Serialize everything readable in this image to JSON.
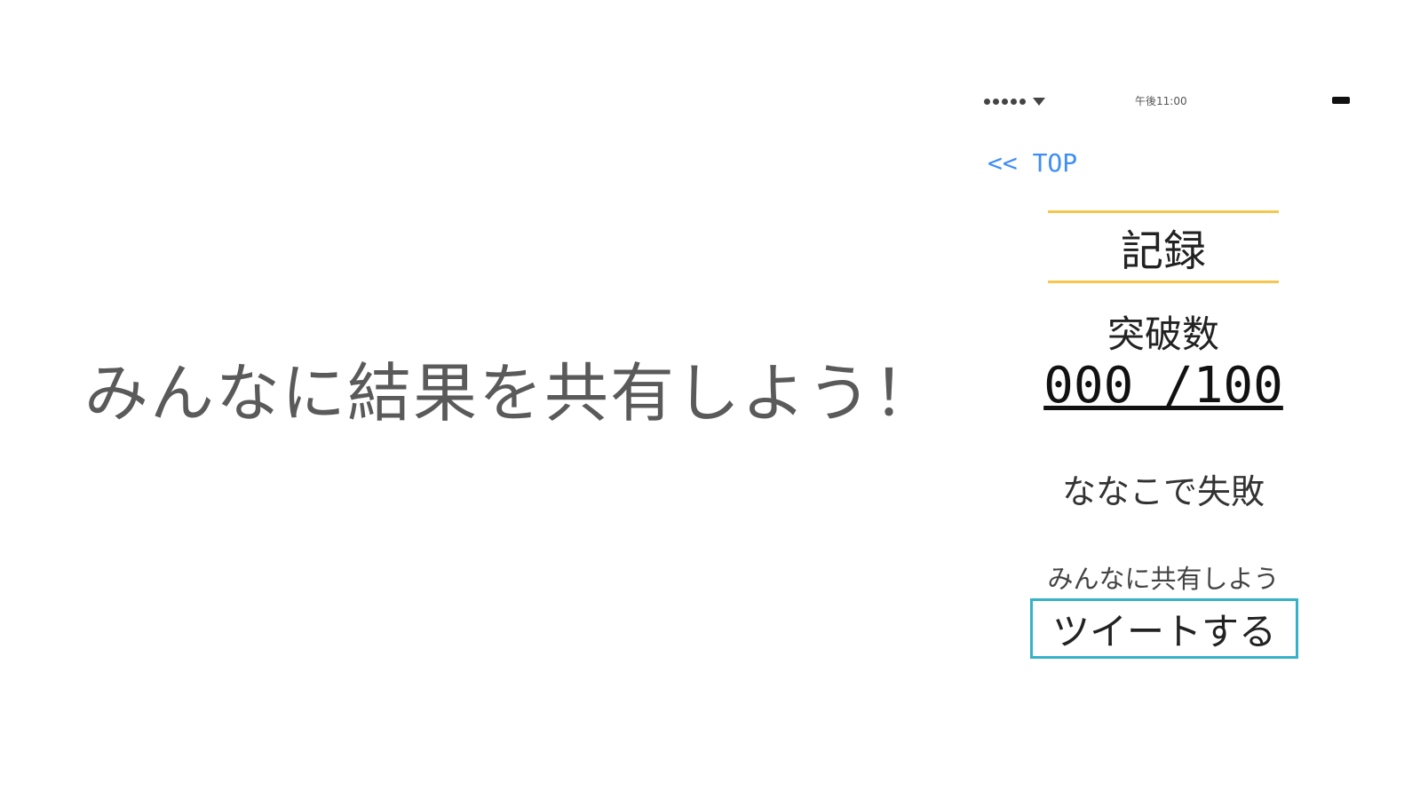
{
  "caption": "みんなに結果を共有しよう！",
  "phone": {
    "status_bar": {
      "time": "午後11:00",
      "signal_icon": "signal-dots-icon",
      "wifi_icon": "wifi-icon",
      "battery_icon": "battery-icon"
    },
    "back_link": "<< TOP",
    "title": "記録",
    "breaks_label": "突破数",
    "score": "000 /100",
    "fail_text": "ななこで失敗",
    "share_label": "みんなに共有しよう",
    "tweet_button": "ツイートする"
  },
  "colors": {
    "link": "#3f8ef5",
    "title_rule": "#f6c64d",
    "button_border": "#35b2c8"
  }
}
